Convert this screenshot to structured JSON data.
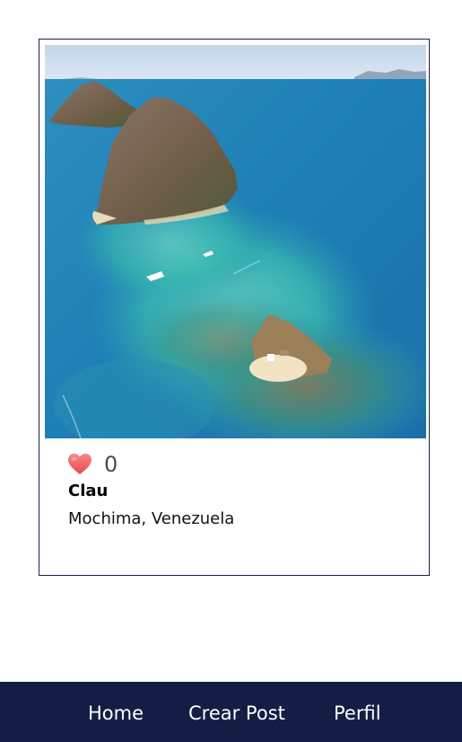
{
  "post": {
    "image": "aerial photo of islands and turquoise reef sea",
    "likes": "0",
    "username": "Clau",
    "location": "Mochima, Venezuela"
  },
  "icons": {
    "like": "heart-icon"
  },
  "colors": {
    "nav_background": "#141e44",
    "card_border": "#1b2347",
    "heart": "#f0595c"
  },
  "nav": {
    "home": "Home",
    "create_post": "Crear Post",
    "profile": "Perfil"
  }
}
